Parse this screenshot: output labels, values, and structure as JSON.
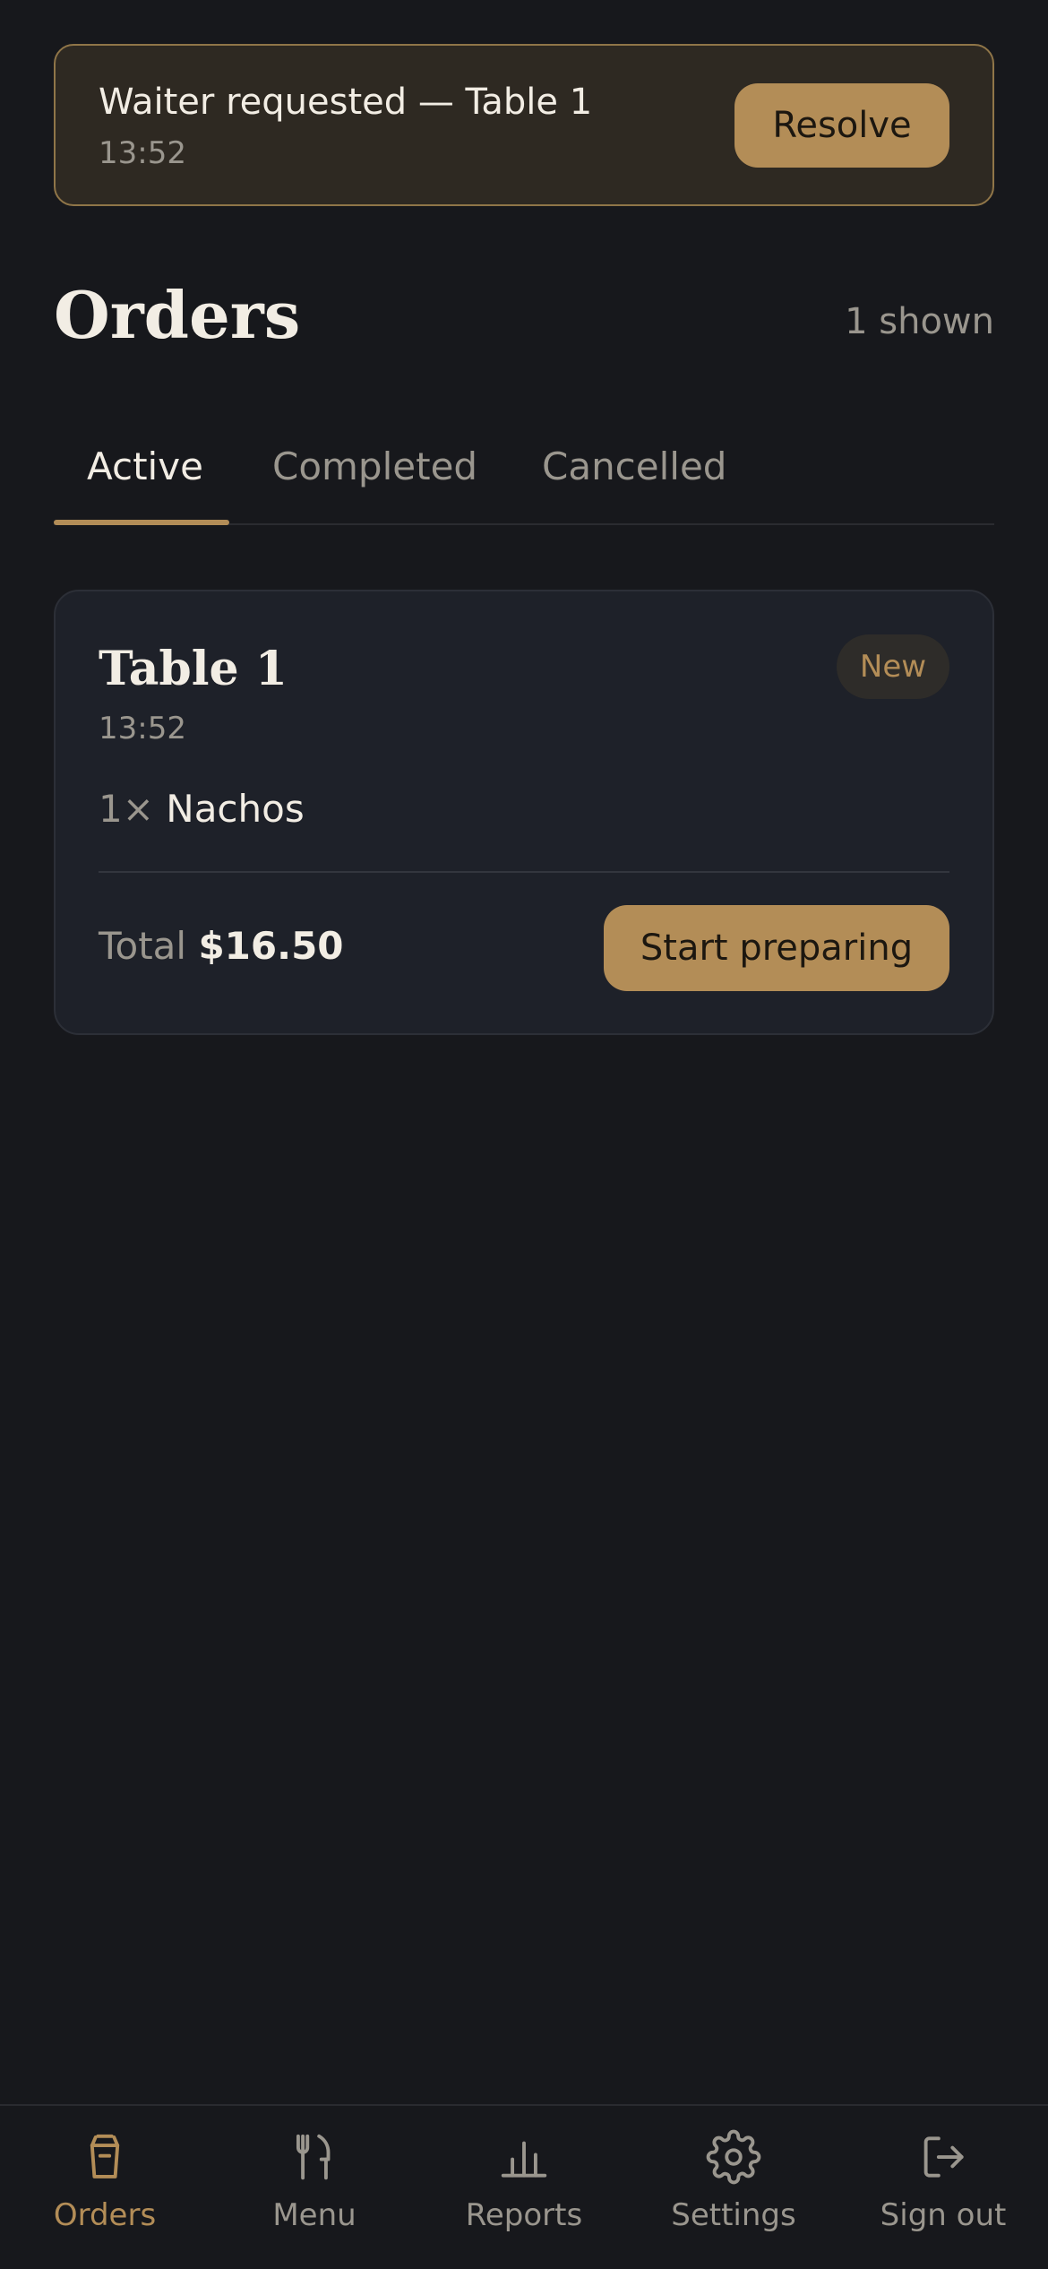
{
  "banner": {
    "title": "Waiter requested — Table 1",
    "time": "13:52",
    "resolve_label": "Resolve"
  },
  "header": {
    "title": "Orders",
    "count": "1 shown"
  },
  "tabs": [
    {
      "label": "Active",
      "active": true
    },
    {
      "label": "Completed",
      "active": false
    },
    {
      "label": "Cancelled",
      "active": false
    }
  ],
  "orders": [
    {
      "table": "Table 1",
      "time": "13:52",
      "status": "New",
      "items": [
        {
          "qty": "1×",
          "name": "Nachos"
        }
      ],
      "total_label": "Total",
      "total": "$16.50",
      "action_label": "Start preparing"
    }
  ],
  "nav": [
    {
      "label": "Orders",
      "icon": "orders-icon",
      "active": true
    },
    {
      "label": "Menu",
      "icon": "utensils-icon",
      "active": false
    },
    {
      "label": "Reports",
      "icon": "bar-chart-icon",
      "active": false
    },
    {
      "label": "Settings",
      "icon": "gear-icon",
      "active": false
    },
    {
      "label": "Sign out",
      "icon": "sign-out-icon",
      "active": false
    }
  ],
  "colors": {
    "background": "#17181c",
    "accent": "#b38d57",
    "card": "#1e2129",
    "banner": "#2e2922",
    "text_primary": "#f2ede4",
    "text_muted": "#9a968e"
  }
}
